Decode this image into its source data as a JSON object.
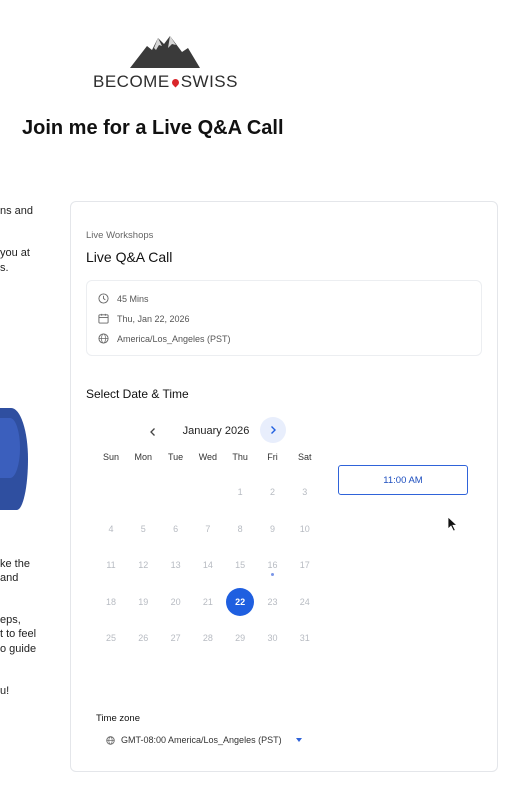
{
  "brand": {
    "left": "BECOME",
    "right": "SWISS"
  },
  "headline": "Join me for a Live Q&A Call",
  "left_fragments": [
    "ns and",
    "you at",
    "s.",
    "ke the",
    "and",
    "eps,",
    "t to feel",
    "o guide",
    "u!"
  ],
  "card": {
    "breadcrumb": "Live Workshops",
    "title": "Live Q&A Call",
    "duration": "45 Mins",
    "date": "Thu, Jan 22, 2026",
    "timezone_info": "America/Los_Angeles (PST)",
    "section_title": "Select Date & Time",
    "month": "January 2026",
    "weekdays": [
      "Sun",
      "Mon",
      "Tue",
      "Wed",
      "Thu",
      "Fri",
      "Sat"
    ],
    "weeks": [
      [
        "",
        "",
        "",
        "",
        "1",
        "2",
        "3"
      ],
      [
        "4",
        "5",
        "6",
        "7",
        "8",
        "9",
        "10"
      ],
      [
        "11",
        "12",
        "13",
        "14",
        "15",
        "16",
        "17"
      ],
      [
        "18",
        "19",
        "20",
        "21",
        "22",
        "23",
        "24"
      ],
      [
        "25",
        "26",
        "27",
        "28",
        "29",
        "30",
        "31"
      ]
    ],
    "selected_day": "22",
    "dotted_day": "16",
    "time_slot": "11:00 AM",
    "timezone_label": "Time zone",
    "timezone_value": "GMT-08:00 America/Los_Angeles (PST)"
  },
  "colors": {
    "accent": "#1f5fe0",
    "disabled_day": "#b7bbc2",
    "brand_pin": "#d9252a"
  },
  "icons": [
    "mountain-logo-icon",
    "clock-icon",
    "calendar-icon",
    "globe-icon",
    "chevron-left-icon",
    "chevron-right-icon",
    "cursor-icon"
  ]
}
